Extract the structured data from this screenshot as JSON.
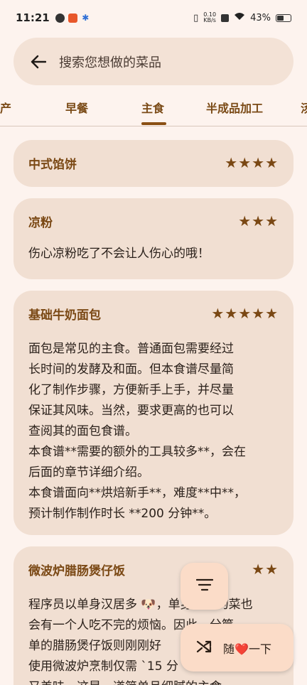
{
  "status_bar": {
    "time": "11:21",
    "net_speed_top": "0.10",
    "net_speed_bottom": "KB/s",
    "battery": "43%"
  },
  "search": {
    "placeholder": "搜索您想做的菜品",
    "back_icon": "arrow-left-icon"
  },
  "tabs": [
    {
      "label": "产",
      "selected": false
    },
    {
      "label": "早餐",
      "selected": false
    },
    {
      "label": "主食",
      "selected": true
    },
    {
      "label": "半成品加工",
      "selected": false
    },
    {
      "label": "汤",
      "selected": false
    }
  ],
  "recipes": [
    {
      "title": "中式馅饼",
      "stars": "★★★★",
      "desc": ""
    },
    {
      "title": "凉粉",
      "stars": "★★★",
      "desc": "伤心凉粉吃了不会让人伤心的哦！"
    },
    {
      "title": "基础牛奶面包",
      "stars": "★★★★★",
      "desc": "面包是常见的主食。普通面包需要经过\n长时间的发酵及和面。但本食谱尽量简\n化了制作步骤，方便新手上手，并尽量\n保证其风味。当然，要求更高的也可以\n查阅其的面包食谱。\n本食谱**需要的额外的工具较多**，会在\n后面的章节详细介绍。\n本食谱面向**烘焙新手**，难度**中**，\n预计制作制作时长 **200 分钟**。"
    },
    {
      "title": "微波炉腊肠煲仔饭",
      "stars": "★★",
      "desc": "程序员以单身汉居多 🐶，单身汉做的菜也\n会有一个人吃不完的烦恼。因此，分筐\n单的腊肠煲仔饭则刚刚好\n使用微波炉烹制仅需 `15 分\n又美味。这是一道简单且细腻的主食"
    }
  ],
  "fab_sort": {
    "icon": "sort-icon"
  },
  "fab_random": {
    "icon": "shuffle-icon",
    "label_pre": "随",
    "label_heart": "❤️",
    "label_post": "一下"
  },
  "colors": {
    "accent": "#7a4814",
    "card": "#f1dfd2",
    "background": "#fdf3ee",
    "fab": "#fbdcc8"
  }
}
